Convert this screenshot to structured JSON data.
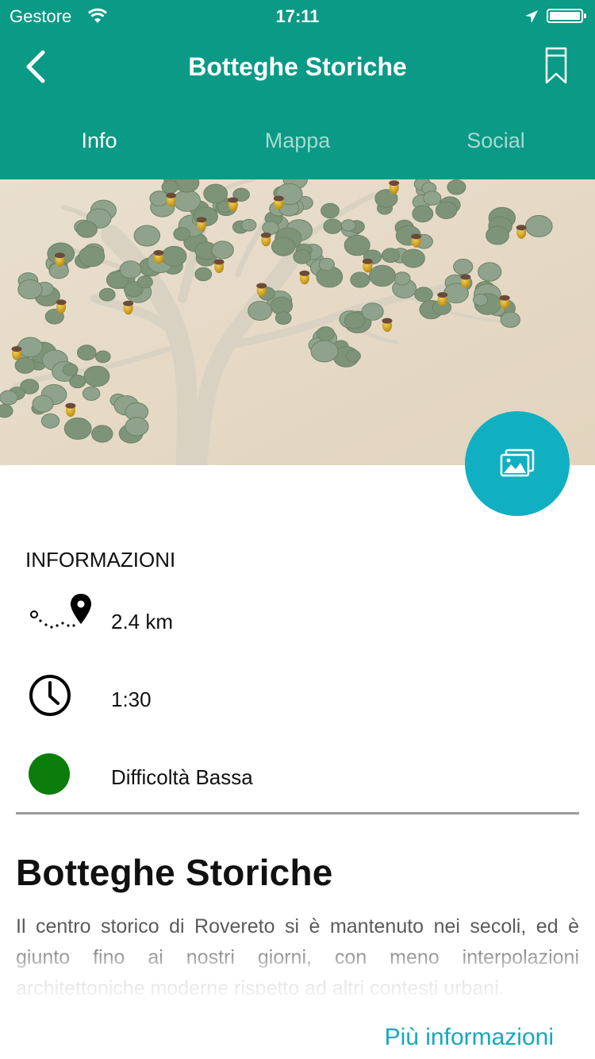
{
  "status_bar": {
    "carrier": "Gestore",
    "time": "17:11"
  },
  "nav": {
    "title": "Botteghe Storiche",
    "back_icon": "chevron-left-icon",
    "bookmark_icon": "bookmark-icon"
  },
  "tabs": [
    {
      "label": "Info",
      "active": true
    },
    {
      "label": "Mappa",
      "active": false
    },
    {
      "label": "Social",
      "active": false
    }
  ],
  "gallery_button": {
    "icon": "gallery-icon"
  },
  "info": {
    "section_title": "INFORMAZIONI",
    "distance": "2.4 km",
    "duration": "1:30",
    "difficulty": "Difficoltà Bassa",
    "difficulty_color": "#0a7d0a"
  },
  "article": {
    "title": "Botteghe Storiche",
    "text": "Il centro storico di Rovereto si è mantenuto nei secoli, ed è giunto fino ai nostri giorni, con meno interpolazioni architettoniche moderne rispetto ad altri contesti urbani."
  },
  "more_link": "Più informazioni",
  "colors": {
    "header": "#0a9a86",
    "accent": "#13a9bd",
    "fab": "#10b0c2"
  }
}
